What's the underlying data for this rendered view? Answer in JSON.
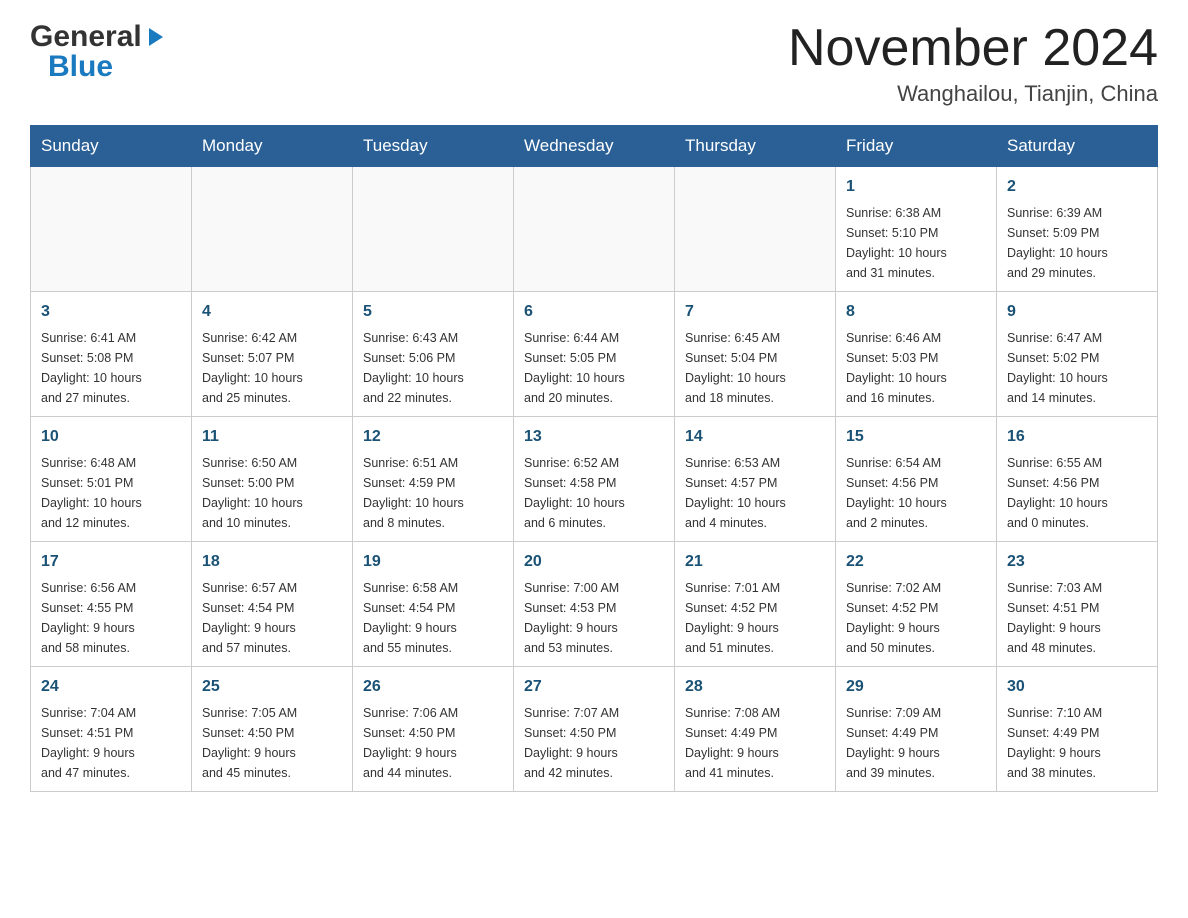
{
  "header": {
    "logo_general": "General",
    "logo_blue": "Blue",
    "month_title": "November 2024",
    "location": "Wanghailou, Tianjin, China"
  },
  "weekdays": [
    "Sunday",
    "Monday",
    "Tuesday",
    "Wednesday",
    "Thursday",
    "Friday",
    "Saturday"
  ],
  "weeks": [
    [
      {
        "day": "",
        "info": ""
      },
      {
        "day": "",
        "info": ""
      },
      {
        "day": "",
        "info": ""
      },
      {
        "day": "",
        "info": ""
      },
      {
        "day": "",
        "info": ""
      },
      {
        "day": "1",
        "info": "Sunrise: 6:38 AM\nSunset: 5:10 PM\nDaylight: 10 hours\nand 31 minutes."
      },
      {
        "day": "2",
        "info": "Sunrise: 6:39 AM\nSunset: 5:09 PM\nDaylight: 10 hours\nand 29 minutes."
      }
    ],
    [
      {
        "day": "3",
        "info": "Sunrise: 6:41 AM\nSunset: 5:08 PM\nDaylight: 10 hours\nand 27 minutes."
      },
      {
        "day": "4",
        "info": "Sunrise: 6:42 AM\nSunset: 5:07 PM\nDaylight: 10 hours\nand 25 minutes."
      },
      {
        "day": "5",
        "info": "Sunrise: 6:43 AM\nSunset: 5:06 PM\nDaylight: 10 hours\nand 22 minutes."
      },
      {
        "day": "6",
        "info": "Sunrise: 6:44 AM\nSunset: 5:05 PM\nDaylight: 10 hours\nand 20 minutes."
      },
      {
        "day": "7",
        "info": "Sunrise: 6:45 AM\nSunset: 5:04 PM\nDaylight: 10 hours\nand 18 minutes."
      },
      {
        "day": "8",
        "info": "Sunrise: 6:46 AM\nSunset: 5:03 PM\nDaylight: 10 hours\nand 16 minutes."
      },
      {
        "day": "9",
        "info": "Sunrise: 6:47 AM\nSunset: 5:02 PM\nDaylight: 10 hours\nand 14 minutes."
      }
    ],
    [
      {
        "day": "10",
        "info": "Sunrise: 6:48 AM\nSunset: 5:01 PM\nDaylight: 10 hours\nand 12 minutes."
      },
      {
        "day": "11",
        "info": "Sunrise: 6:50 AM\nSunset: 5:00 PM\nDaylight: 10 hours\nand 10 minutes."
      },
      {
        "day": "12",
        "info": "Sunrise: 6:51 AM\nSunset: 4:59 PM\nDaylight: 10 hours\nand 8 minutes."
      },
      {
        "day": "13",
        "info": "Sunrise: 6:52 AM\nSunset: 4:58 PM\nDaylight: 10 hours\nand 6 minutes."
      },
      {
        "day": "14",
        "info": "Sunrise: 6:53 AM\nSunset: 4:57 PM\nDaylight: 10 hours\nand 4 minutes."
      },
      {
        "day": "15",
        "info": "Sunrise: 6:54 AM\nSunset: 4:56 PM\nDaylight: 10 hours\nand 2 minutes."
      },
      {
        "day": "16",
        "info": "Sunrise: 6:55 AM\nSunset: 4:56 PM\nDaylight: 10 hours\nand 0 minutes."
      }
    ],
    [
      {
        "day": "17",
        "info": "Sunrise: 6:56 AM\nSunset: 4:55 PM\nDaylight: 9 hours\nand 58 minutes."
      },
      {
        "day": "18",
        "info": "Sunrise: 6:57 AM\nSunset: 4:54 PM\nDaylight: 9 hours\nand 57 minutes."
      },
      {
        "day": "19",
        "info": "Sunrise: 6:58 AM\nSunset: 4:54 PM\nDaylight: 9 hours\nand 55 minutes."
      },
      {
        "day": "20",
        "info": "Sunrise: 7:00 AM\nSunset: 4:53 PM\nDaylight: 9 hours\nand 53 minutes."
      },
      {
        "day": "21",
        "info": "Sunrise: 7:01 AM\nSunset: 4:52 PM\nDaylight: 9 hours\nand 51 minutes."
      },
      {
        "day": "22",
        "info": "Sunrise: 7:02 AM\nSunset: 4:52 PM\nDaylight: 9 hours\nand 50 minutes."
      },
      {
        "day": "23",
        "info": "Sunrise: 7:03 AM\nSunset: 4:51 PM\nDaylight: 9 hours\nand 48 minutes."
      }
    ],
    [
      {
        "day": "24",
        "info": "Sunrise: 7:04 AM\nSunset: 4:51 PM\nDaylight: 9 hours\nand 47 minutes."
      },
      {
        "day": "25",
        "info": "Sunrise: 7:05 AM\nSunset: 4:50 PM\nDaylight: 9 hours\nand 45 minutes."
      },
      {
        "day": "26",
        "info": "Sunrise: 7:06 AM\nSunset: 4:50 PM\nDaylight: 9 hours\nand 44 minutes."
      },
      {
        "day": "27",
        "info": "Sunrise: 7:07 AM\nSunset: 4:50 PM\nDaylight: 9 hours\nand 42 minutes."
      },
      {
        "day": "28",
        "info": "Sunrise: 7:08 AM\nSunset: 4:49 PM\nDaylight: 9 hours\nand 41 minutes."
      },
      {
        "day": "29",
        "info": "Sunrise: 7:09 AM\nSunset: 4:49 PM\nDaylight: 9 hours\nand 39 minutes."
      },
      {
        "day": "30",
        "info": "Sunrise: 7:10 AM\nSunset: 4:49 PM\nDaylight: 9 hours\nand 38 minutes."
      }
    ]
  ]
}
